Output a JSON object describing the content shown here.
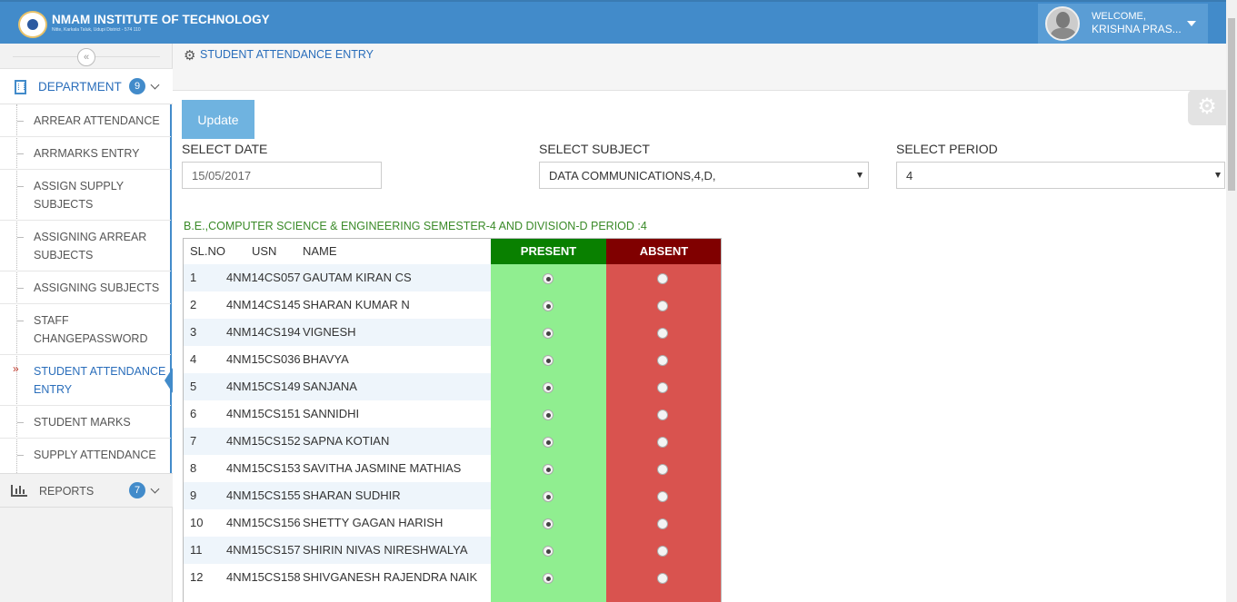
{
  "header": {
    "institute": "NMAM INSTITUTE OF TECHNOLOGY",
    "institute_sub": "Nitte, Karkala Taluk, Udupi District - 574 110",
    "welcome": "WELCOME,",
    "user_name": "KRISHNA PRAS..."
  },
  "sidebar": {
    "collapse_icon": "double-chevron-left-icon",
    "department": {
      "label": "DEPARTMENT",
      "badge": "9"
    },
    "items": [
      {
        "label": "ARREAR ATTENDANCE"
      },
      {
        "label": "ARRMARKS ENTRY"
      },
      {
        "label": "ASSIGN SUPPLY SUBJECTS"
      },
      {
        "label": "ASSIGNING ARREAR SUBJECTS"
      },
      {
        "label": "ASSIGNING SUBJECTS"
      },
      {
        "label": "STAFF CHANGEPASSWORD"
      },
      {
        "label": "STUDENT ATTENDANCE ENTRY",
        "active": true
      },
      {
        "label": "STUDENT MARKS"
      },
      {
        "label": "SUPPLY ATTENDANCE"
      }
    ],
    "reports": {
      "label": "REPORTS",
      "badge": "7"
    }
  },
  "breadcrumb": {
    "label": "STUDENT ATTENDANCE ENTRY"
  },
  "form": {
    "update_label": "Update",
    "date_label": "SELECT DATE",
    "date_value": "15/05/2017",
    "subject_label": "SELECT SUBJECT",
    "subject_value": "DATA COMMUNICATIONS,4,D,",
    "period_label": "SELECT PERIOD",
    "period_value": "4"
  },
  "caption": "B.E.,COMPUTER SCIENCE & ENGINEERING SEMESTER-4 AND DIVISION-D PERIOD :4",
  "table": {
    "headers": {
      "slno": "SL.NO",
      "usn": "USN",
      "name": "NAME",
      "present": "PRESENT",
      "absent": "ABSENT"
    },
    "colors": {
      "present_header": "#098000",
      "absent_header": "#800000",
      "present_col": "#90ee90",
      "absent_col": "#d9534f"
    },
    "rows": [
      {
        "sl": "1",
        "usn": "4NM14CS057",
        "name": "GAUTAM KIRAN CS",
        "status": "present"
      },
      {
        "sl": "2",
        "usn": "4NM14CS145",
        "name": "SHARAN KUMAR N",
        "status": "present"
      },
      {
        "sl": "3",
        "usn": "4NM14CS194",
        "name": "VIGNESH",
        "status": "present"
      },
      {
        "sl": "4",
        "usn": "4NM15CS036",
        "name": "BHAVYA",
        "status": "present"
      },
      {
        "sl": "5",
        "usn": "4NM15CS149",
        "name": "SANJANA",
        "status": "present"
      },
      {
        "sl": "6",
        "usn": "4NM15CS151",
        "name": "SANNIDHI",
        "status": "present"
      },
      {
        "sl": "7",
        "usn": "4NM15CS152",
        "name": "SAPNA KOTIAN",
        "status": "present"
      },
      {
        "sl": "8",
        "usn": "4NM15CS153",
        "name": "SAVITHA JASMINE MATHIAS",
        "status": "present"
      },
      {
        "sl": "9",
        "usn": "4NM15CS155",
        "name": "SHARAN SUDHIR",
        "status": "present"
      },
      {
        "sl": "10",
        "usn": "4NM15CS156",
        "name": "SHETTY GAGAN HARISH",
        "status": "present"
      },
      {
        "sl": "11",
        "usn": "4NM15CS157",
        "name": "SHIRIN NIVAS NIRESHWALYA",
        "status": "present"
      },
      {
        "sl": "12",
        "usn": "4NM15CS158",
        "name": "SHIVGANESH RAJENDRA NAIK",
        "status": "present"
      }
    ]
  }
}
